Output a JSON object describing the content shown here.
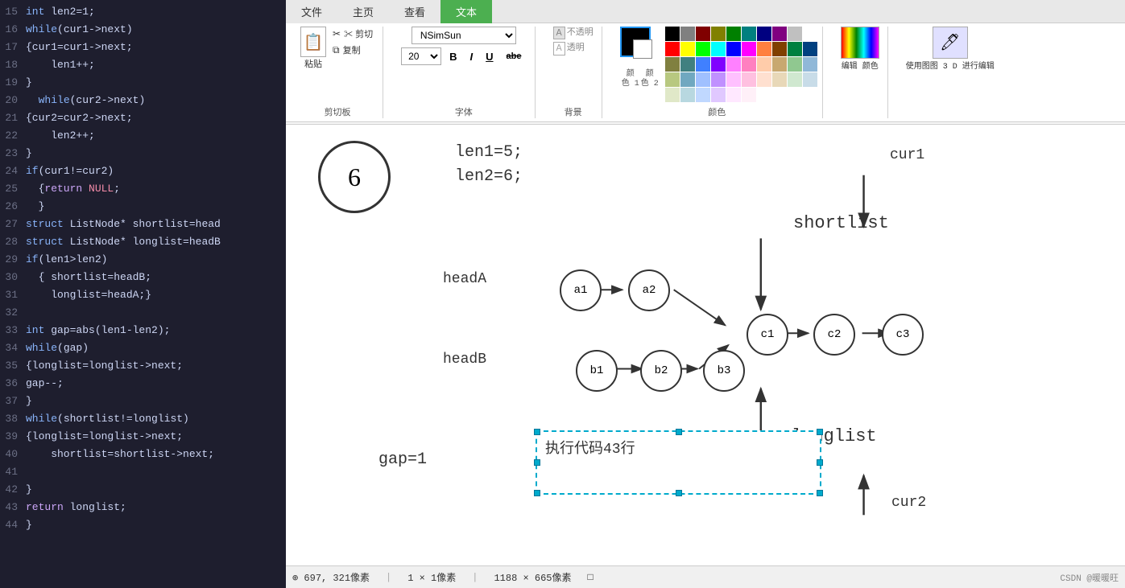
{
  "tabs": [
    {
      "label": "文件",
      "active": false
    },
    {
      "label": "主页",
      "active": false
    },
    {
      "label": "查看",
      "active": false
    },
    {
      "label": "文本",
      "active": true,
      "highlighted": true
    }
  ],
  "toolbar": {
    "paste_label": "粘贴",
    "cut_label": "✂ 剪切",
    "copy_label": "复制",
    "clipboard_group": "剪切板",
    "font_name": "NSimSun",
    "font_size": "20",
    "bold": "B",
    "italic": "I",
    "underline": "U",
    "strikethrough": "abe",
    "font_group": "字体",
    "opacity_label": "不透明",
    "transparent_label": "透明",
    "bg_group": "背景",
    "color1_label": "颜\n色 1",
    "color2_label": "颜\n色 2",
    "color_group": "颜色",
    "edit_color_label": "编辑\n颜色",
    "use_3d_label": "使用图图 3\nD 进行编辑"
  },
  "code": [
    {
      "num": "15",
      "text": "int len2=1;",
      "keywords": []
    },
    {
      "num": "16",
      "text": "while(cur1->next)",
      "keywords": [
        "while"
      ]
    },
    {
      "num": "17",
      "text": "{cur1=cur1->next;",
      "keywords": []
    },
    {
      "num": "18",
      "text": "    len1++;",
      "keywords": []
    },
    {
      "num": "19",
      "text": "}",
      "keywords": []
    },
    {
      "num": "20",
      "text": "  while(cur2->next)",
      "keywords": [
        "while"
      ]
    },
    {
      "num": "21",
      "text": "{cur2=cur2->next;",
      "keywords": []
    },
    {
      "num": "22",
      "text": "    len2++;",
      "keywords": []
    },
    {
      "num": "23",
      "text": "}",
      "keywords": []
    },
    {
      "num": "24",
      "text": "if(cur1!=cur2)",
      "keywords": [
        "if"
      ]
    },
    {
      "num": "25",
      "text": "  {return NULL;",
      "keywords": [
        "return"
      ]
    },
    {
      "num": "26",
      "text": "  }",
      "keywords": []
    },
    {
      "num": "27",
      "text": "struct ListNode* shortlist=head",
      "keywords": [
        "struct"
      ]
    },
    {
      "num": "28",
      "text": "struct ListNode* longlist=headB",
      "keywords": [
        "struct"
      ]
    },
    {
      "num": "29",
      "text": "if(len1>len2)",
      "keywords": [
        "if"
      ]
    },
    {
      "num": "30",
      "text": "  { shortlist=headB;",
      "keywords": []
    },
    {
      "num": "31",
      "text": "    longlist=headA;}",
      "keywords": []
    },
    {
      "num": "32",
      "text": "",
      "keywords": []
    },
    {
      "num": "33",
      "text": "int gap=abs(len1-len2);",
      "keywords": [
        "int"
      ]
    },
    {
      "num": "34",
      "text": "while(gap)",
      "keywords": [
        "while"
      ]
    },
    {
      "num": "35",
      "text": "{longlist=longlist->next;",
      "keywords": []
    },
    {
      "num": "36",
      "text": "gap--;",
      "keywords": []
    },
    {
      "num": "37",
      "text": "}",
      "keywords": []
    },
    {
      "num": "38",
      "text": "while(shortlist!=longlist)",
      "keywords": [
        "while"
      ]
    },
    {
      "num": "39",
      "text": "{longlist=longlist->next;",
      "keywords": []
    },
    {
      "num": "40",
      "text": "    shortlist=shortlist->next;",
      "keywords": []
    },
    {
      "num": "41",
      "text": "",
      "keywords": []
    },
    {
      "num": "42",
      "text": "}",
      "keywords": []
    },
    {
      "num": "43",
      "text": "return longlist;",
      "keywords": [
        "return"
      ]
    },
    {
      "num": "44",
      "text": "}",
      "keywords": []
    }
  ],
  "diagram": {
    "circle6": "6",
    "text_len": "len1=5;\nlen2=6;",
    "cur1_label": "cur1",
    "cur2_label": "cur2",
    "shortlist_label": "shortlist",
    "longlist_label": "longlist",
    "headA_label": "headA",
    "headB_label": "headB",
    "gap_label": "gap=1",
    "textbox_content": "执行代码43行",
    "nodes": {
      "a1": "a1",
      "a2": "a2",
      "b1": "b1",
      "b2": "b2",
      "b3": "b3",
      "c1": "c1",
      "c2": "c2",
      "c3": "c3"
    }
  },
  "status_bar": {
    "item1": "⊕ 697, 321像素",
    "item2": "1 × 1像素",
    "item3": "1188 × 665像素",
    "watermark": "CSDN @暖暖旺"
  },
  "colors": {
    "palette": [
      "#000000",
      "#808080",
      "#800000",
      "#808000",
      "#008000",
      "#008080",
      "#000080",
      "#800080",
      "#c0c0c0",
      "#ffffff",
      "#ff0000",
      "#ffff00",
      "#00ff00",
      "#00ffff",
      "#0000ff",
      "#ff00ff",
      "#ff8040",
      "#804000",
      "#008040",
      "#004080",
      "#808040",
      "#408080",
      "#4080ff",
      "#8000ff",
      "#ff80ff",
      "#ff80c0",
      "#ffccaa",
      "#c8a870",
      "#90c890",
      "#90b8d8",
      "#b8c880",
      "#70a8c0",
      "#a0c0ff",
      "#c090ff",
      "#ffc0ff",
      "#ffc0e0",
      "#ffe0d0",
      "#e8d8b8",
      "#d0e8d0",
      "#c8dce8",
      "#e0e8c8",
      "#b8d8e0",
      "#c0d8ff",
      "#e0c8ff",
      "#ffe8ff",
      "#fff0f8"
    ]
  }
}
